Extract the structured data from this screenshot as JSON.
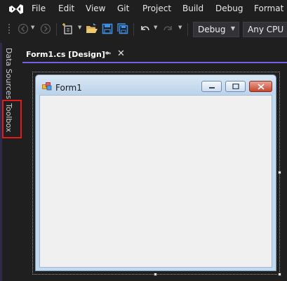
{
  "menu": {
    "items": [
      "File",
      "Edit",
      "View",
      "Git",
      "Project",
      "Build",
      "Debug",
      "Format"
    ]
  },
  "toolbar": {
    "configuration": "Debug",
    "platform": "Any CPU"
  },
  "side_panel": {
    "tabs": [
      "Data Sources",
      "Toolbox"
    ]
  },
  "document": {
    "tab_title": "Form1.cs [Design]*",
    "pin_glyph": "⊸",
    "close_glyph": "✕"
  },
  "form": {
    "title": "Form1"
  },
  "colors": {
    "accent": "#7160e8",
    "highlight": "#e01d1d",
    "background": "#1f1f1f"
  },
  "icons": [
    "visual-studio-logo-icon",
    "back-icon",
    "forward-icon",
    "new-item-icon",
    "open-folder-icon",
    "save-icon",
    "save-all-icon",
    "undo-icon",
    "redo-icon",
    "form-icon",
    "minimize-icon",
    "maximize-icon",
    "close-icon"
  ]
}
